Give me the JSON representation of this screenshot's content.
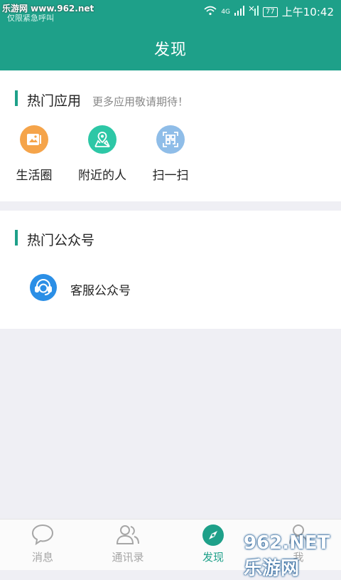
{
  "status": {
    "watermark": "乐游网 www.962.net",
    "emergency": "仅限紧急呼叫",
    "net": "4G",
    "battery": "77",
    "time": "上午10:42"
  },
  "header": {
    "title": "发现"
  },
  "hot_apps": {
    "title": "热门应用",
    "subtitle": "更多应用敬请期待！",
    "items": [
      {
        "label": "生活圈",
        "icon": "album-icon",
        "color": "#f5a44a"
      },
      {
        "label": "附近的人",
        "icon": "location-map-icon",
        "color": "#2dc7a6"
      },
      {
        "label": "扫一扫",
        "icon": "scan-icon",
        "color": "#8fbde8"
      }
    ]
  },
  "public_accounts": {
    "title": "热门公众号",
    "items": [
      {
        "label": "客服公众号",
        "icon": "customer-service-icon",
        "color": "#2b8fe6"
      }
    ]
  },
  "tabbar": {
    "items": [
      {
        "label": "消息",
        "icon": "chat-bubble-icon",
        "active": false
      },
      {
        "label": "通讯录",
        "icon": "contacts-icon",
        "active": false
      },
      {
        "label": "发现",
        "icon": "compass-icon",
        "active": true
      },
      {
        "label": "我",
        "icon": "profile-icon",
        "active": false
      }
    ],
    "active_color": "#1ea089",
    "inactive_color": "#a6a6a6"
  },
  "watermark_bottom": "962.NET 乐游网"
}
